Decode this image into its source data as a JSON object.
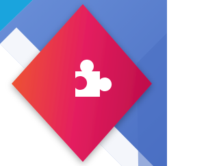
{
  "app_tile": {
    "icon": "puzzle-piece-icon",
    "colors": {
      "background": "#ffffff",
      "cyan_band": "#1aa4dd",
      "blue_band": "#4a6fc3",
      "blue_band_light": "#6a8fd8",
      "white_stripe": "#f4f6fb",
      "diamond_left": "#ef5a2c",
      "diamond_mid": "#e41e5f",
      "diamond_right": "#c20f4c",
      "glyph": "#ffffff"
    }
  }
}
